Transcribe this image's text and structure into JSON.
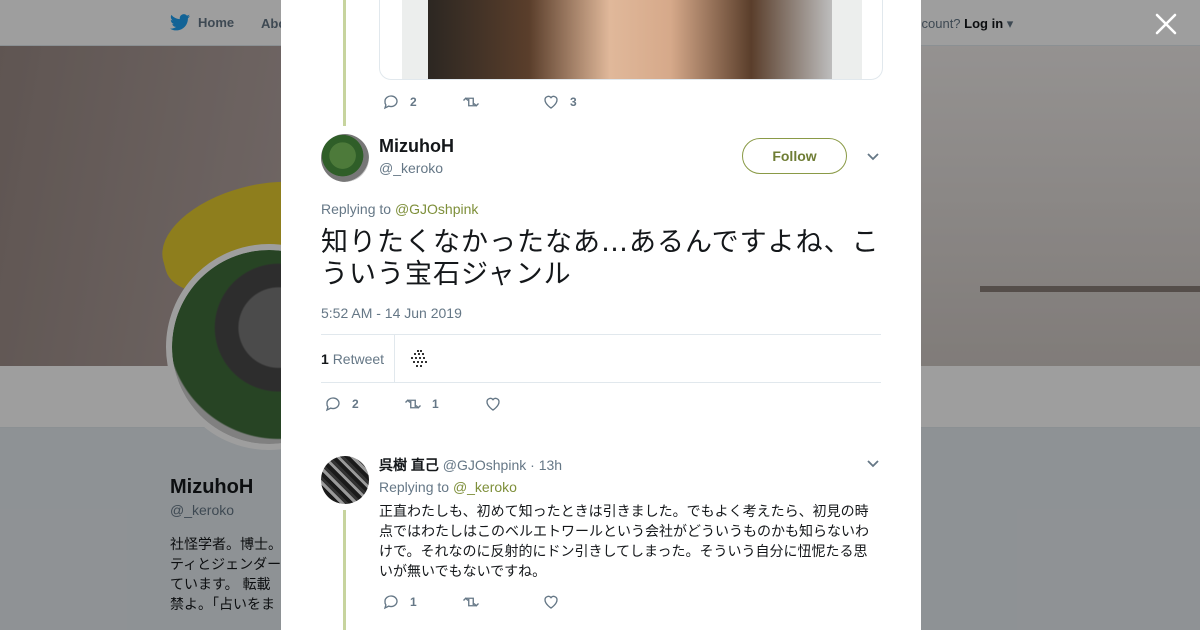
{
  "topbar": {
    "home_label": "Home",
    "about_label": "Abo",
    "account_prompt": "ccount?",
    "login_label": "Log in"
  },
  "profile": {
    "name": "MizuhoH",
    "handle": "@_keroko",
    "bio": "社怪学者。博士。ティとジェンダーています。 転載禁よ。「占いをまと"
  },
  "prev_tweet": {
    "reply_count": "2",
    "retweet_count": "",
    "like_count": "3"
  },
  "main_tweet": {
    "name": "MizuhoH",
    "handle": "@_keroko",
    "follow_label": "Follow",
    "replying_prefix": "Replying to",
    "replying_to": "@GJOshpink",
    "text": "知りたくなかったなあ…あるんですよね、こういう宝石ジャンル",
    "timestamp": "5:52 AM - 14 Jun 2019",
    "retweets_number": "1",
    "retweets_label": "Retweet",
    "reply_count": "2",
    "retweet_count": "1",
    "like_count": ""
  },
  "reply": {
    "name": "呉樹 直己",
    "handle": "@GJOshpink",
    "age": "· 13h",
    "replying_prefix": "Replying to",
    "replying_to": "@_keroko",
    "text": "正直わたしも、初めて知ったときは引きました。でもよく考えたら、初見の時点ではわたしはこのベルエトワールという会社がどういうものかも知らないわけで。それなのに反射的にドン引きしてしまった。そういう自分に忸怩たる思いが無いでもないですね。",
    "reply_count": "1",
    "retweet_count": "",
    "like_count": ""
  },
  "colors": {
    "accent": "#7e8f3a",
    "thread_line": "#c7d49e",
    "text_secondary": "#657786"
  },
  "icons": [
    "twitter-bird-icon",
    "close-icon",
    "reply-icon",
    "retweet-icon",
    "heart-icon",
    "chevron-down-icon"
  ]
}
